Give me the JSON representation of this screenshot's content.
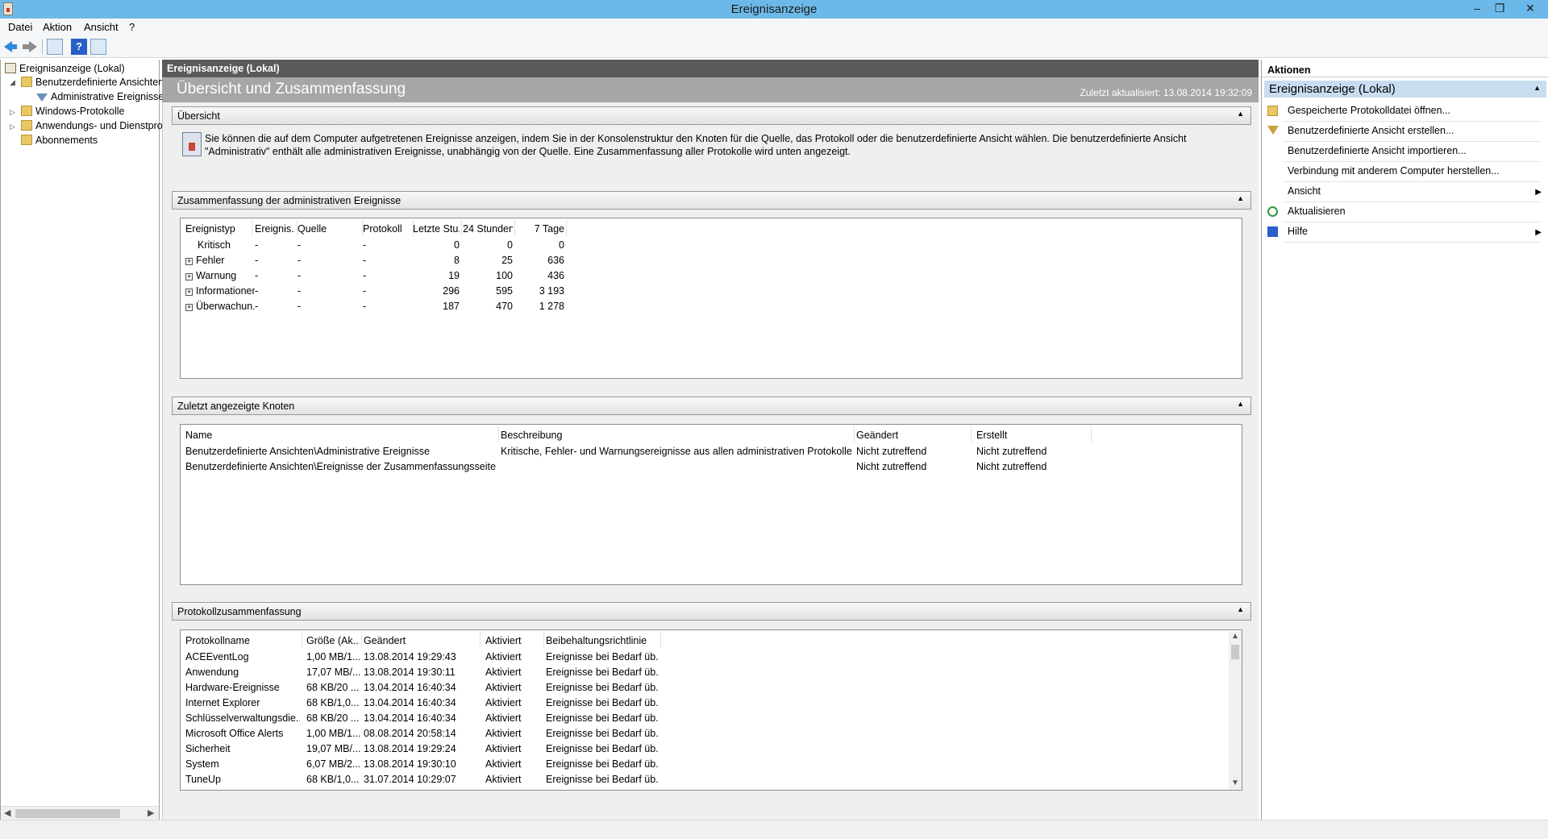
{
  "window": {
    "title": "Ereignisanzeige"
  },
  "menu": [
    "Datei",
    "Aktion",
    "Ansicht",
    "?"
  ],
  "tree": {
    "root": "Ereignisanzeige (Lokal)",
    "items": [
      {
        "label": "Benutzerdefinierte Ansichten",
        "level": 1,
        "expanded": true
      },
      {
        "label": "Administrative Ereignisse",
        "level": 2
      },
      {
        "label": "Windows-Protokolle",
        "level": 1
      },
      {
        "label": "Anwendungs- und Dienstprotokolle",
        "level": 1
      },
      {
        "label": "Abonnements",
        "level": 1
      }
    ]
  },
  "center": {
    "header": "Ereignisanzeige (Lokal)",
    "banner_title": "Übersicht und Zusammenfassung",
    "last_updated": "Zuletzt aktualisiert: 13.08.2014 19:32:09",
    "overview": {
      "title": "Übersicht",
      "text": "Sie können die auf dem Computer aufgetretenen Ereignisse anzeigen, indem Sie in der Konsolenstruktur den Knoten für die Quelle, das Protokoll oder die benutzerdefinierte Ansicht wählen. Die benutzerdefinierte Ansicht \"Administrativ\" enthält alle administrativen Ereignisse, unabhängig von der Quelle. Eine Zusammenfassung aller Protokolle wird unten angezeigt."
    },
    "admin_summary": {
      "title": "Zusammenfassung der administrativen Ereignisse",
      "columns": [
        "Ereignistyp",
        "Ereignis...",
        "Quelle",
        "Protokoll",
        "Letzte Stu...",
        "24 Stunden",
        "7 Tage"
      ],
      "rows": [
        {
          "type": "Kritisch",
          "expand": false,
          "id": "-",
          "source": "-",
          "log": "-",
          "hour": "0",
          "day": "0",
          "week": "0"
        },
        {
          "type": "Fehler",
          "expand": true,
          "id": "-",
          "source": "-",
          "log": "-",
          "hour": "8",
          "day": "25",
          "week": "636"
        },
        {
          "type": "Warnung",
          "expand": true,
          "id": "-",
          "source": "-",
          "log": "-",
          "hour": "19",
          "day": "100",
          "week": "436"
        },
        {
          "type": "Informationen",
          "expand": true,
          "id": "-",
          "source": "-",
          "log": "-",
          "hour": "296",
          "day": "595",
          "week": "3 193"
        },
        {
          "type": "Überwachun...",
          "expand": true,
          "id": "-",
          "source": "-",
          "log": "-",
          "hour": "187",
          "day": "470",
          "week": "1 278"
        }
      ]
    },
    "recent_nodes": {
      "title": "Zuletzt angezeigte Knoten",
      "columns": [
        "Name",
        "Beschreibung",
        "Geändert",
        "Erstellt"
      ],
      "rows": [
        {
          "name": "Benutzerdefinierte Ansichten\\Administrative Ereignisse",
          "desc": "Kritische, Fehler- und Warnungsereignisse aus allen administrativen Protokollen",
          "changed": "Nicht zutreffend",
          "created": "Nicht zutreffend"
        },
        {
          "name": "Benutzerdefinierte Ansichten\\Ereignisse der Zusammenfassungsseite",
          "desc": "",
          "changed": "Nicht zutreffend",
          "created": "Nicht zutreffend"
        }
      ]
    },
    "log_summary": {
      "title": "Protokollzusammenfassung",
      "columns": [
        "Protokollname",
        "Größe (Ak...",
        "Geändert",
        "Aktiviert",
        "Beibehaltungsrichtlinie"
      ],
      "rows": [
        {
          "name": "ACEEventLog",
          "size": "1,00 MB/1...",
          "changed": "13.08.2014 19:29:43",
          "enabled": "Aktiviert",
          "policy": "Ereignisse bei Bedarf üb..."
        },
        {
          "name": "Anwendung",
          "size": "17,07 MB/...",
          "changed": "13.08.2014 19:30:11",
          "enabled": "Aktiviert",
          "policy": "Ereignisse bei Bedarf üb..."
        },
        {
          "name": "Hardware-Ereignisse",
          "size": "68 KB/20 ...",
          "changed": "13.04.2014 16:40:34",
          "enabled": "Aktiviert",
          "policy": "Ereignisse bei Bedarf üb..."
        },
        {
          "name": "Internet Explorer",
          "size": "68 KB/1,0...",
          "changed": "13.04.2014 16:40:34",
          "enabled": "Aktiviert",
          "policy": "Ereignisse bei Bedarf üb..."
        },
        {
          "name": "Schlüsselverwaltungsdie...",
          "size": "68 KB/20 ...",
          "changed": "13.04.2014 16:40:34",
          "enabled": "Aktiviert",
          "policy": "Ereignisse bei Bedarf üb..."
        },
        {
          "name": "Microsoft Office Alerts",
          "size": "1,00 MB/1...",
          "changed": "08.08.2014 20:58:14",
          "enabled": "Aktiviert",
          "policy": "Ereignisse bei Bedarf üb..."
        },
        {
          "name": "Sicherheit",
          "size": "19,07 MB/...",
          "changed": "13.08.2014 19:29:24",
          "enabled": "Aktiviert",
          "policy": "Ereignisse bei Bedarf üb..."
        },
        {
          "name": "System",
          "size": "6,07 MB/2...",
          "changed": "13.08.2014 19:30:10",
          "enabled": "Aktiviert",
          "policy": "Ereignisse bei Bedarf üb..."
        },
        {
          "name": "TuneUp",
          "size": "68 KB/1,0...",
          "changed": "31.07.2014 10:29:07",
          "enabled": "Aktiviert",
          "policy": "Ereignisse bei Bedarf üb..."
        }
      ]
    }
  },
  "actions": {
    "title": "Aktionen",
    "group": "Ereignisanzeige (Lokal)",
    "items": [
      {
        "label": "Gespeicherte Protokolldatei öffnen...",
        "icon": "open-log-icon",
        "submenu": false
      },
      {
        "label": "Benutzerdefinierte Ansicht erstellen...",
        "icon": "filter-icon",
        "submenu": false
      },
      {
        "label": "Benutzerdefinierte Ansicht importieren...",
        "icon": "",
        "submenu": false
      },
      {
        "label": "Verbindung mit anderem Computer herstellen...",
        "icon": "",
        "submenu": false
      },
      {
        "label": "Ansicht",
        "icon": "",
        "submenu": true
      },
      {
        "label": "Aktualisieren",
        "icon": "refresh-icon",
        "submenu": false
      },
      {
        "label": "Hilfe",
        "icon": "help-icon",
        "submenu": true
      }
    ]
  }
}
